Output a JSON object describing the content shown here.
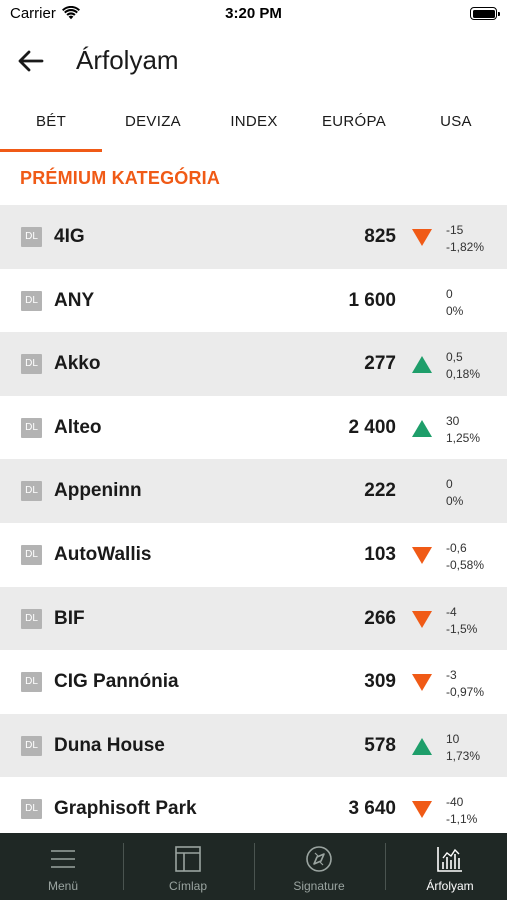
{
  "status": {
    "carrier": "Carrier",
    "time": "3:20 PM"
  },
  "header": {
    "title": "Árfolyam"
  },
  "tabs": [
    {
      "label": "BÉT",
      "active": true
    },
    {
      "label": "DEVIZA",
      "active": false
    },
    {
      "label": "INDEX",
      "active": false
    },
    {
      "label": "EURÓPA",
      "active": false
    },
    {
      "label": "USA",
      "active": false
    }
  ],
  "section": {
    "title": "PRÉMIUM KATEGÓRIA"
  },
  "colors": {
    "accent": "#f05a16",
    "up": "#1e9e6a",
    "down": "#f05a16",
    "row_shade": "#ebebeb",
    "nav_bg": "#1f2825"
  },
  "stocks": [
    {
      "badge": "DL",
      "name": "4IG",
      "price": "825",
      "trend": "down",
      "change": "-15",
      "change_pct": "-1,82%"
    },
    {
      "badge": "DL",
      "name": "ANY",
      "price": "1 600",
      "trend": "none",
      "change": "0",
      "change_pct": "0%"
    },
    {
      "badge": "DL",
      "name": "Akko",
      "price": "277",
      "trend": "up",
      "change": "0,5",
      "change_pct": "0,18%"
    },
    {
      "badge": "DL",
      "name": "Alteo",
      "price": "2 400",
      "trend": "up",
      "change": "30",
      "change_pct": "1,25%"
    },
    {
      "badge": "DL",
      "name": "Appeninn",
      "price": "222",
      "trend": "none",
      "change": "0",
      "change_pct": "0%"
    },
    {
      "badge": "DL",
      "name": "AutoWallis",
      "price": "103",
      "trend": "down",
      "change": "-0,6",
      "change_pct": "-0,58%"
    },
    {
      "badge": "DL",
      "name": "BIF",
      "price": "266",
      "trend": "down",
      "change": "-4",
      "change_pct": "-1,5%"
    },
    {
      "badge": "DL",
      "name": "CIG Pannónia",
      "price": "309",
      "trend": "down",
      "change": "-3",
      "change_pct": "-0,97%"
    },
    {
      "badge": "DL",
      "name": "Duna House",
      "price": "578",
      "trend": "up",
      "change": "10",
      "change_pct": "1,73%"
    },
    {
      "badge": "DL",
      "name": "Graphisoft Park",
      "price": "3 640",
      "trend": "down",
      "change": "-40",
      "change_pct": "-1,1%"
    }
  ],
  "nav": [
    {
      "label": "Menü",
      "icon": "menu-icon",
      "active": false
    },
    {
      "label": "Címlap",
      "icon": "layout-icon",
      "active": false
    },
    {
      "label": "Signature",
      "icon": "compass-icon",
      "active": false
    },
    {
      "label": "Árfolyam",
      "icon": "chart-icon",
      "active": true
    }
  ]
}
